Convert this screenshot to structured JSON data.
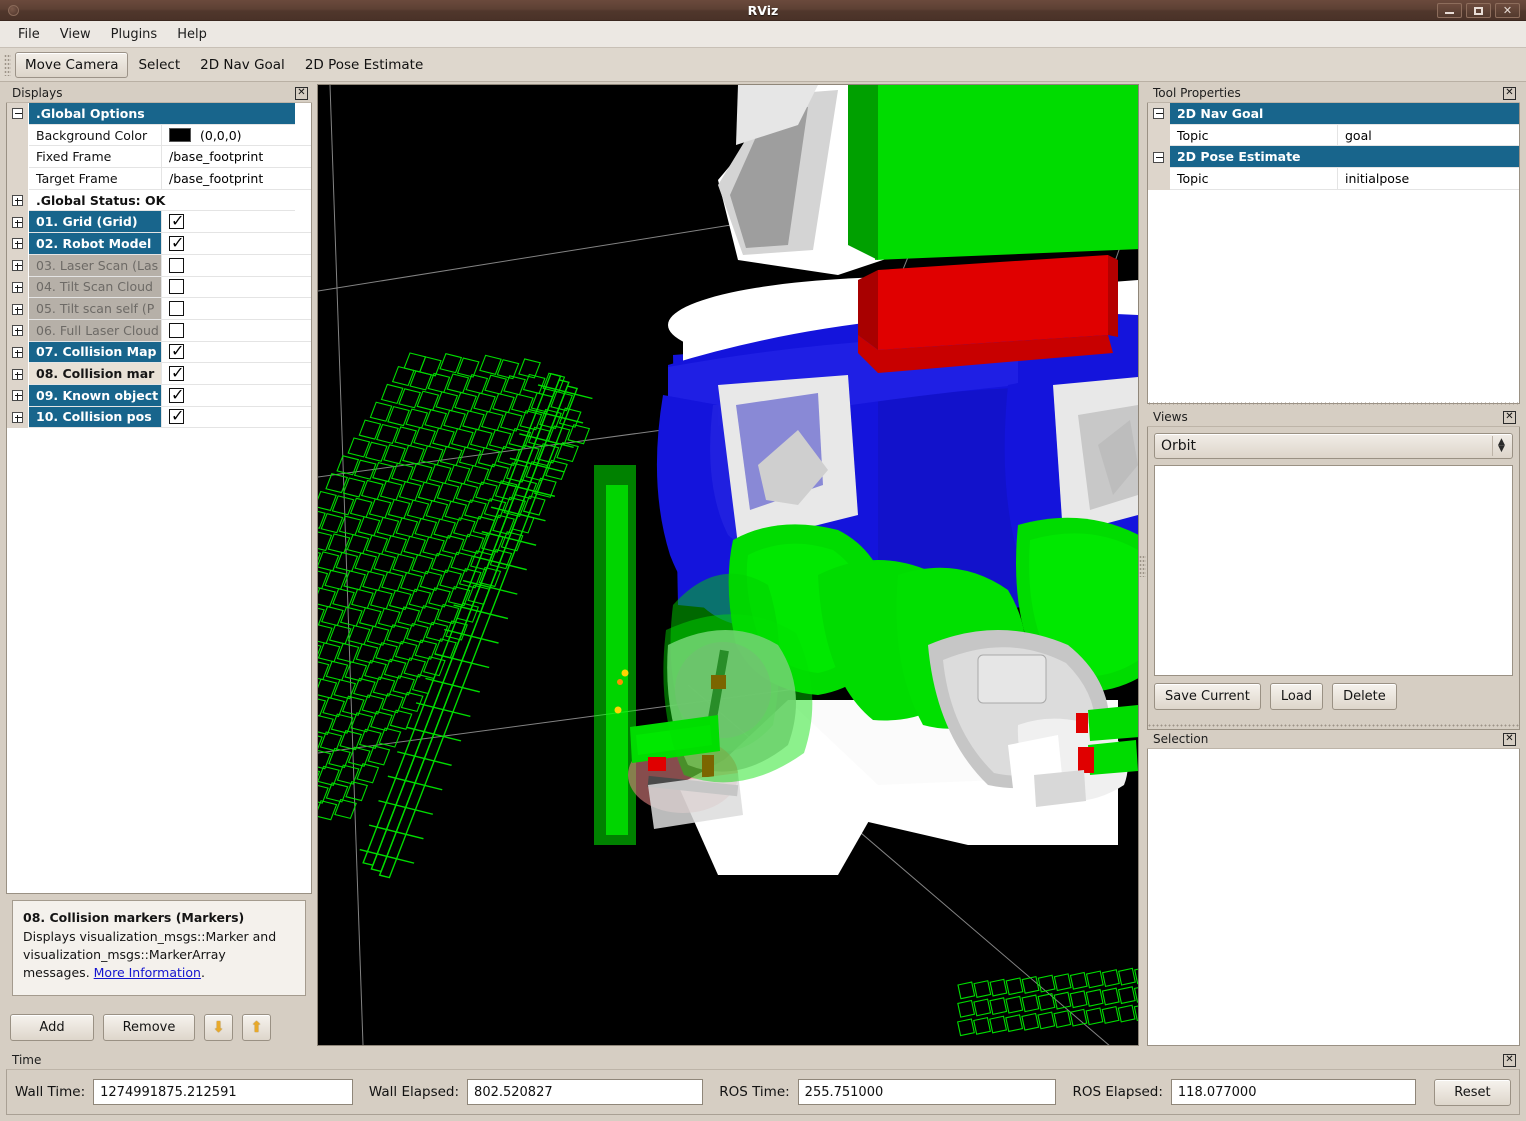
{
  "window": {
    "title": "RViz",
    "minimize_label": "_",
    "maximize_label": "□",
    "close_label": "✕"
  },
  "menu": {
    "items": [
      {
        "label": "File"
      },
      {
        "label": "View"
      },
      {
        "label": "Plugins"
      },
      {
        "label": "Help"
      }
    ]
  },
  "toolbar": {
    "buttons": [
      {
        "label": "Move Camera",
        "active": true
      },
      {
        "label": "Select",
        "active": false
      },
      {
        "label": "2D Nav Goal",
        "active": false
      },
      {
        "label": "2D Pose Estimate",
        "active": false
      }
    ]
  },
  "displays": {
    "title": "Displays",
    "close_label": "✕",
    "global_options": {
      "label": ".Global Options",
      "rows": [
        {
          "name": "Background Color",
          "value": "(0,0,0)",
          "color": "#000000"
        },
        {
          "name": "Fixed Frame",
          "value": "/base_footprint"
        },
        {
          "name": "Target Frame",
          "value": "/base_footprint"
        }
      ]
    },
    "global_status": ".Global Status: OK",
    "items": [
      {
        "label": "01. Grid (Grid)",
        "checked": true,
        "state": "sel"
      },
      {
        "label": "02. Robot Model",
        "checked": true,
        "state": "sel"
      },
      {
        "label": "03. Laser Scan (Las",
        "checked": false,
        "state": "dim"
      },
      {
        "label": "04. Tilt Scan Cloud",
        "checked": false,
        "state": "dim"
      },
      {
        "label": "05. Tilt scan self (P",
        "checked": false,
        "state": "dim"
      },
      {
        "label": "06. Full Laser Cloud",
        "checked": false,
        "state": "dim"
      },
      {
        "label": "07. Collision Map",
        "checked": true,
        "state": "sel"
      },
      {
        "label": "08. Collision mar",
        "checked": true,
        "state": "focus"
      },
      {
        "label": "09. Known object",
        "checked": true,
        "state": "sel"
      },
      {
        "label": "10. Collision pos",
        "checked": true,
        "state": "sel"
      }
    ],
    "help": {
      "title": "08. Collision markers (Markers)",
      "text_before": "Displays visualization_msgs::Marker and visualization_msgs::MarkerArray messages. ",
      "link": "More Information",
      "text_after": "."
    },
    "buttons": {
      "add": "Add",
      "remove": "Remove",
      "move_down": "⬇",
      "move_up": "⬆"
    }
  },
  "tool_properties": {
    "title": "Tool Properties",
    "close_label": "✕",
    "groups": [
      {
        "label": "2D Nav Goal",
        "rows": [
          {
            "name": "Topic",
            "value": "goal"
          }
        ]
      },
      {
        "label": "2D Pose Estimate",
        "rows": [
          {
            "name": "Topic",
            "value": "initialpose"
          }
        ]
      }
    ]
  },
  "views": {
    "title": "Views",
    "close_label": "✕",
    "selected_mode": "Orbit",
    "buttons": {
      "save_current": "Save Current",
      "load": "Load",
      "delete": "Delete"
    }
  },
  "selection": {
    "title": "Selection",
    "close_label": "✕"
  },
  "time": {
    "title": "Time",
    "close_label": "✕",
    "fields": [
      {
        "label": "Wall Time:",
        "value": "1274991875.212591"
      },
      {
        "label": "Wall Elapsed:",
        "value": "802.520827"
      },
      {
        "label": "ROS Time:",
        "value": "255.751000"
      },
      {
        "label": "ROS Elapsed:",
        "value": "118.077000"
      }
    ],
    "reset_label": "Reset"
  },
  "viewport": {
    "background_color": "#000000",
    "grid_line_color": "#9a9a9a",
    "collision_voxel_color": "#00e000",
    "robot_colors": {
      "body_white": "#f4f4f4",
      "body_blue": "#1414dc",
      "accent_green": "#00dc00",
      "accent_red": "#e00000",
      "metal_grey": "#b4b4b4"
    }
  }
}
